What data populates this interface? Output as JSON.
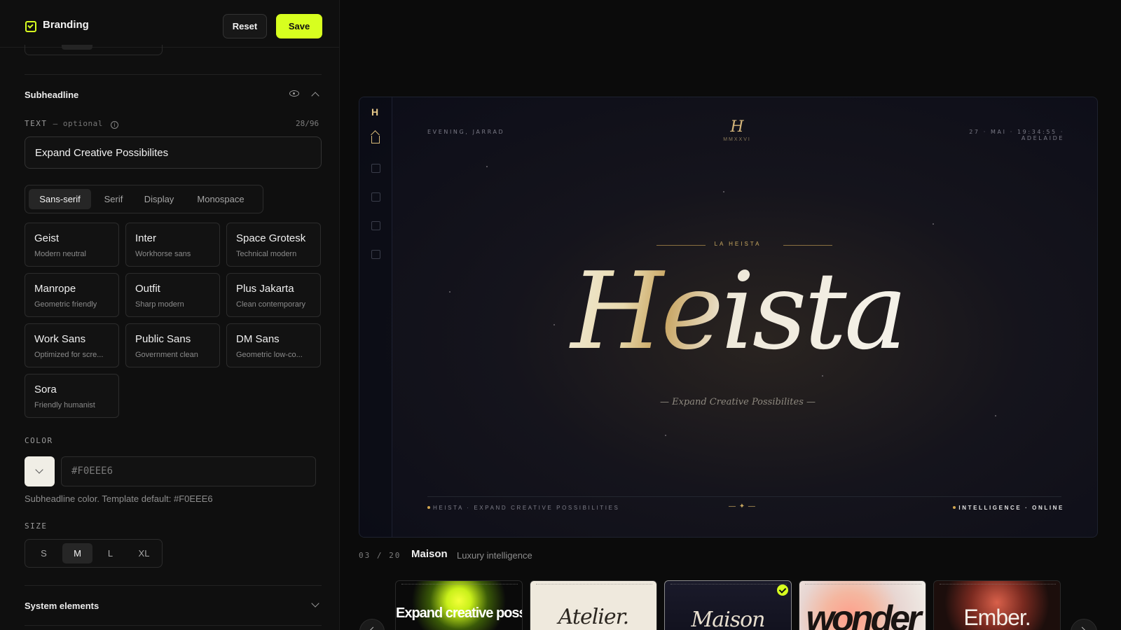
{
  "header": {
    "title": "Branding",
    "reset_label": "Reset",
    "save_label": "Save"
  },
  "subheadline": {
    "section_title": "Subheadline",
    "text_label": "TEXT",
    "optional_label": "— optional",
    "counter": "28/96",
    "text_value": "Expand Creative Possibilites",
    "font_categories": [
      "Sans-serif",
      "Serif",
      "Display",
      "Monospace"
    ],
    "active_category": "Sans-serif",
    "fonts": [
      {
        "name": "Geist",
        "desc": "Modern neutral"
      },
      {
        "name": "Inter",
        "desc": "Workhorse sans"
      },
      {
        "name": "Space Grotesk",
        "desc": "Technical modern"
      },
      {
        "name": "Manrope",
        "desc": "Geometric friendly"
      },
      {
        "name": "Outfit",
        "desc": "Sharp modern"
      },
      {
        "name": "Plus Jakarta",
        "desc": "Clean contemporary"
      },
      {
        "name": "Work Sans",
        "desc": "Optimized for scre..."
      },
      {
        "name": "Public Sans",
        "desc": "Government clean"
      },
      {
        "name": "DM Sans",
        "desc": "Geometric low-co..."
      },
      {
        "name": "Sora",
        "desc": "Friendly humanist"
      }
    ],
    "color_label": "COLOR",
    "color_value": "#F0EEE6",
    "color_help": "Subheadline color. Template default: #F0EEE6",
    "size_label": "SIZE",
    "sizes": [
      "S",
      "M",
      "L",
      "XL"
    ],
    "active_size": "M"
  },
  "system_elements": {
    "title": "System elements"
  },
  "preview": {
    "rail_logo": "H",
    "greeting": "EVENING, JARRAD",
    "monogram": "H",
    "year": "MMXXVI",
    "datetime": "27 · MAI · 19:34:55 · ADELAIDE",
    "kicker": "LA HEISTA",
    "hero": "Heista",
    "tagline": "— Expand Creative Possibilites —",
    "footer_left": "HEISTA · EXPAND CREATIVE POSSIBILITIES",
    "footer_mid": "— ✦ —",
    "footer_right": "INTELLIGENCE · ONLINE",
    "accent_color": "#C9A860"
  },
  "template_meta": {
    "index": "03 / 20",
    "name": "Maison",
    "desc": "Luxury intelligence"
  },
  "templates": [
    {
      "label": "Expand creative possibilities"
    },
    {
      "label": "Atelier."
    },
    {
      "label": "Maison",
      "selected": true
    },
    {
      "label": "wonder"
    },
    {
      "label": "Ember."
    }
  ],
  "colors": {
    "accent": "#D7FF1F",
    "panel": "#0F0F0F",
    "preview_bg": "#0C0D18"
  }
}
